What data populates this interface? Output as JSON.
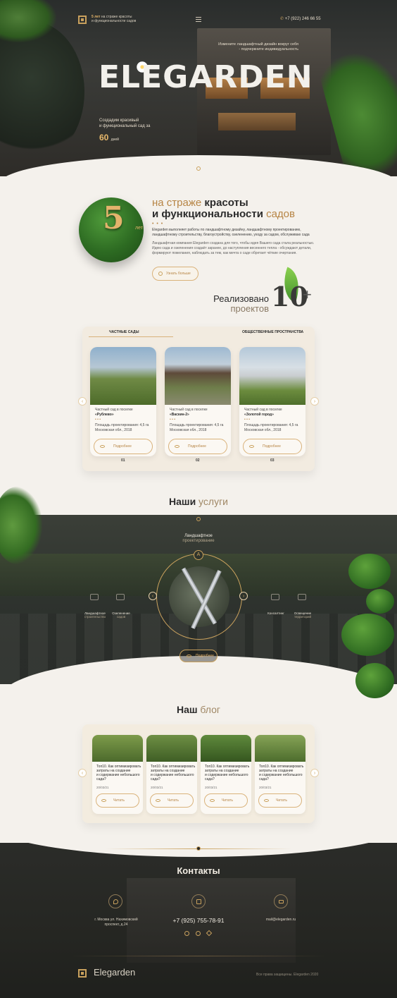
{
  "header": {
    "tagline_bold": "5 лет",
    "tagline_rest_1": " на страже красоты",
    "tagline_rest_2": "и функциональности садов",
    "phone": "+7 (922) 246 66 55"
  },
  "hero": {
    "title": "ELEGARDEN",
    "subtitle_line1": "Измените ландшафтный дизайн вокруг себя",
    "subtitle_line2": "- подчеркните индивидуальность",
    "left_line1": "Создадим красивый",
    "left_line2": "и функциональный сад за",
    "days_number": "60",
    "days_label": "дней"
  },
  "about": {
    "badge_number": "5",
    "badge_caption": "лет",
    "title_l1_a": "на страже ",
    "title_l1_b": "красоты",
    "title_l2_a": "и функциональности",
    "title_l2_b": " садов",
    "dots": "• • •",
    "para1_line1": "Elegarden выполняет работы по ландшафтному дизайну, ландшафтному проектированию,",
    "para1_line2": "ландшафтному строительству, благоустройству, озеленению, уходу за садом, обслуживаю сада",
    "para2_line1": "Ландшафтная компания Elegarden создана для того, чтобы идея Вашего сада стала реальностью.",
    "para2_line2": "Идею сада и озеленения создаёт заранее, до наступления весеннего тепла - обсуждают детали,",
    "para2_line3": "формируют пожелания, наблюдать за тем, как мечта о саде обретает чёткие очертания.",
    "button": "Узнать больше"
  },
  "realized": {
    "line1": "Реализовано",
    "line2": "проектов",
    "number": "10",
    "plus": "+"
  },
  "projects": {
    "tab_private": "ЧАСТНЫЕ САДЫ",
    "tab_public": "ОБЩЕСТВЕННЫЕ ПРОСТРАНСТВА",
    "prev_arrow": "‹",
    "next_arrow": "›",
    "cards": [
      {
        "caption": "Частный сад в поселке",
        "title": "«Рублево»",
        "dots": "• • •",
        "area": "Площадь проектирования: 4,5 га",
        "location": "Московская обл., 2018",
        "button": "Подробнее",
        "num": "01"
      },
      {
        "caption": "Частный сад в поселке",
        "title": "«Васкин-2»",
        "dots": "• • •",
        "area": "Площадь проектирования: 4,5 га",
        "location": "Московская обл., 2018",
        "button": "Подробнее",
        "num": "02"
      },
      {
        "caption": "Частный сад в поселке",
        "title": "«Золотой город»",
        "dots": "• • •",
        "area": "Площадь проектирования: 4,5 га",
        "location": "Московская обл., 2018",
        "button": "Подробнее",
        "num": "03"
      }
    ]
  },
  "services": {
    "title_a": "Наши",
    "title_b": " услуги",
    "active_l1": "Ландшафтное",
    "active_l2": "проектирование",
    "left1_l1": "Ландшафтное",
    "left1_l2": "строительство",
    "left2_l1": "Озеленение",
    "left2_l2": "садов",
    "right1_l1": "Консалтинг",
    "right1_l2": "",
    "right2_l1": "Освещение",
    "right2_l2": "территорий",
    "prev": "‹",
    "next": "›",
    "button": "Подробнее"
  },
  "blog": {
    "title_a": "Наш",
    "title_b": " блог",
    "prev": "‹",
    "next": "›",
    "posts": [
      {
        "title_l1": "Топ10. Как оптимизировать",
        "title_l2": "затраты на создание",
        "title_l3": "и содержание небольшого",
        "title_l4": "сада?",
        "date": "20/03/21",
        "button": "Читать"
      },
      {
        "title_l1": "Топ10. Как оптимизировать",
        "title_l2": "затраты на создание",
        "title_l3": "и содержание небольшого",
        "title_l4": "сада?",
        "date": "20/03/21",
        "button": "Читать"
      },
      {
        "title_l1": "Топ10. Как оптимизировать",
        "title_l2": "затраты на создание",
        "title_l3": "и содержание небольшого",
        "title_l4": "сада?",
        "date": "20/03/21",
        "button": "Читать"
      },
      {
        "title_l1": "Топ10. Как оптимизировать",
        "title_l2": "затраты на создание",
        "title_l3": "и содержание небольшого",
        "title_l4": "сада?",
        "date": "20/03/21",
        "button": "Читать"
      }
    ]
  },
  "contacts": {
    "title": "Контакты",
    "address_l1": "г. Москва ул. Нахимовский",
    "address_l2": "проспект, д.24",
    "phone": "+7 (925) 755-78-91",
    "email": "mail@elegarden.ru"
  },
  "footer": {
    "logo_text": "Elegarden",
    "copyright": "Все права защищены. Elegarden 2020"
  },
  "colors": {
    "accent_gold": "#c9a15d",
    "dark_bg": "#2a2d2c",
    "light_bg": "#f4f1ec"
  }
}
